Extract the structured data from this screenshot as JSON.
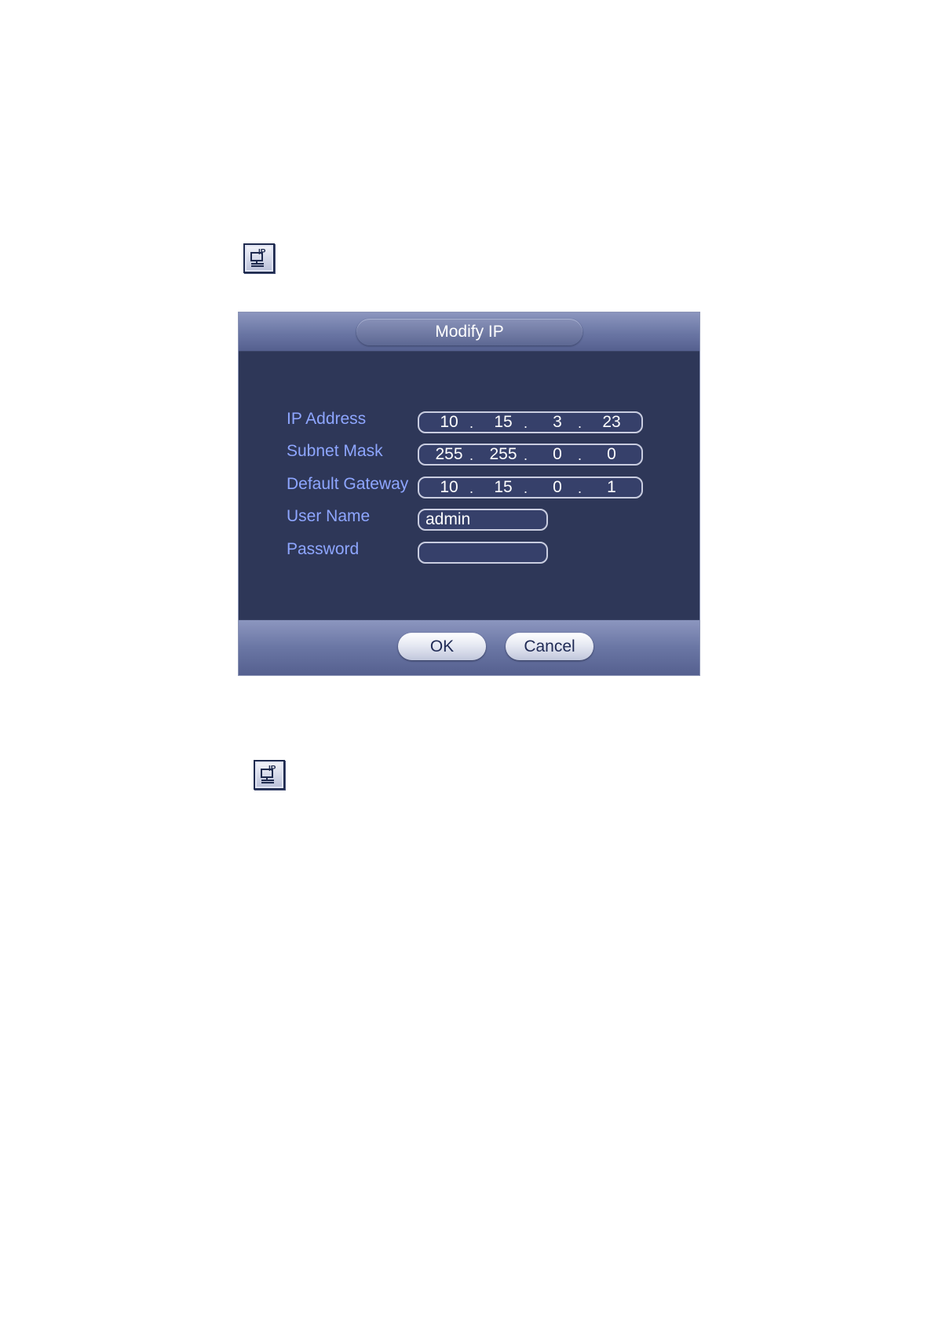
{
  "icons": {
    "top": "ip-monitor-icon",
    "bottom": "ip-monitor-icon"
  },
  "dialog": {
    "title": "Modify IP",
    "fields": {
      "ip_address": {
        "label": "IP Address",
        "octets": [
          "10",
          "15",
          "3",
          "23"
        ]
      },
      "subnet_mask": {
        "label": "Subnet Mask",
        "octets": [
          "255",
          "255",
          "0",
          "0"
        ]
      },
      "default_gateway": {
        "label": "Default Gateway",
        "octets": [
          "10",
          "15",
          "0",
          "1"
        ]
      },
      "user_name": {
        "label": "User Name",
        "value": "admin"
      },
      "password": {
        "label": "Password",
        "value": ""
      }
    },
    "ok_label": "OK",
    "cancel_label": "Cancel"
  },
  "colors": {
    "panel_bg": "#2e3758",
    "bar_bg": "#6a76a4",
    "label_text": "#8ea6ff",
    "value_text": "#ffffff"
  }
}
